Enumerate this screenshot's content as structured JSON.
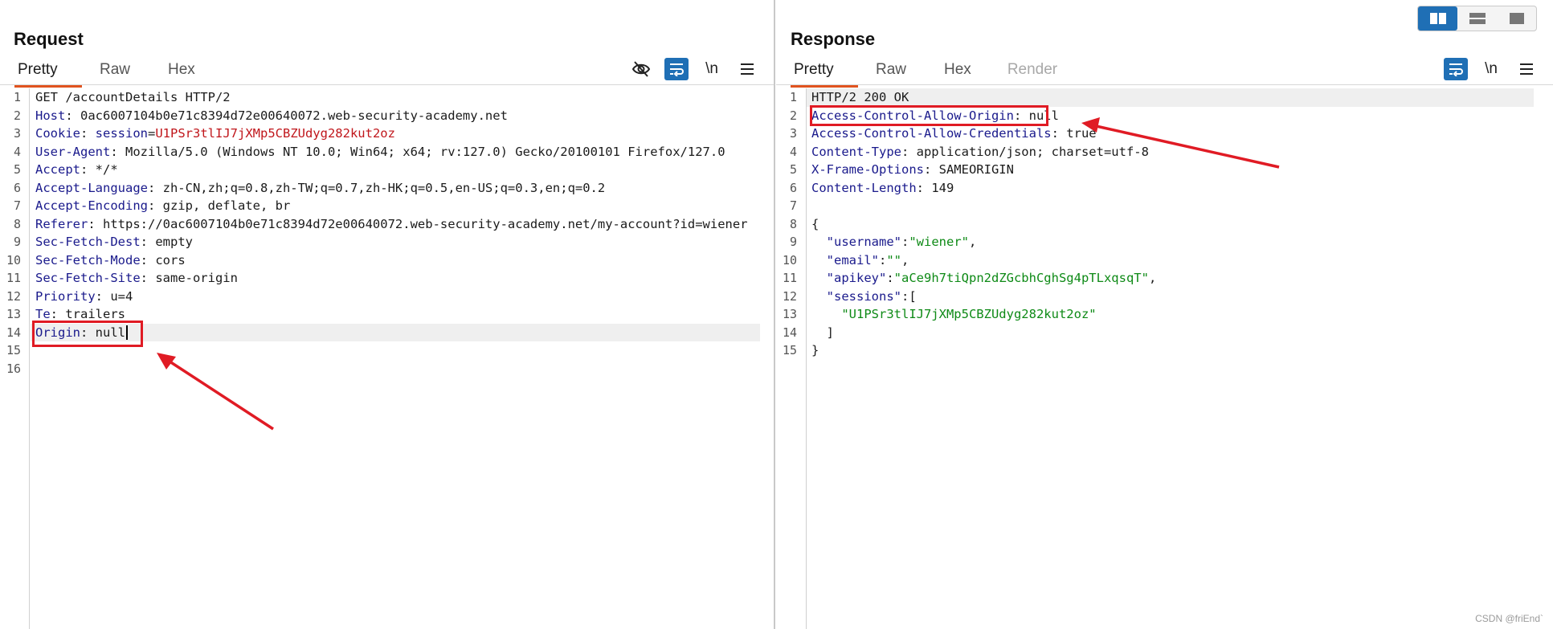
{
  "request": {
    "title": "Request",
    "tabs": [
      "Pretty",
      "Raw",
      "Hex"
    ],
    "active_tab": "Pretty",
    "tools": [
      "eye-off-icon",
      "wrap-icon",
      "\\n",
      "menu-icon"
    ],
    "lines": [
      {
        "n": "1",
        "parts": [
          {
            "t": "GET /accountDetails HTTP/2",
            "c": "v"
          }
        ]
      },
      {
        "n": "2",
        "parts": [
          {
            "t": "Host",
            "c": "k"
          },
          {
            "t": ": 0ac6007104b0e71c8394d72e00640072.web-security-academy.net",
            "c": "v"
          }
        ]
      },
      {
        "n": "3",
        "parts": [
          {
            "t": "Cookie",
            "c": "k"
          },
          {
            "t": ": ",
            "c": "v"
          },
          {
            "t": "session",
            "c": "k"
          },
          {
            "t": "=",
            "c": "v"
          },
          {
            "t": "U1PSr3tlIJ7jXMp5CBZUdyg282kut2oz",
            "c": "cookie-val"
          }
        ]
      },
      {
        "n": "4",
        "parts": [
          {
            "t": "User-Agent",
            "c": "k"
          },
          {
            "t": ": Mozilla/5.0 (Windows NT 10.0; Win64; x64; rv:127.0) Gecko/20100101 Firefox/127.0",
            "c": "v"
          }
        ]
      },
      {
        "n": "5",
        "parts": [
          {
            "t": "Accept",
            "c": "k"
          },
          {
            "t": ": */*",
            "c": "v"
          }
        ]
      },
      {
        "n": "6",
        "parts": [
          {
            "t": "Accept-Language",
            "c": "k"
          },
          {
            "t": ": zh-CN,zh;q=0.8,zh-TW;q=0.7,zh-HK;q=0.5,en-US;q=0.3,en;q=0.2",
            "c": "v"
          }
        ]
      },
      {
        "n": "7",
        "parts": [
          {
            "t": "Accept-Encoding",
            "c": "k"
          },
          {
            "t": ": gzip, deflate, br",
            "c": "v"
          }
        ]
      },
      {
        "n": "8",
        "parts": [
          {
            "t": "Referer",
            "c": "k"
          },
          {
            "t": ": https://0ac6007104b0e71c8394d72e00640072.web-security-academy.net/my-account?id=wiener",
            "c": "v"
          }
        ]
      },
      {
        "n": "9",
        "parts": [
          {
            "t": "Sec-Fetch-Dest",
            "c": "k"
          },
          {
            "t": ": empty",
            "c": "v"
          }
        ]
      },
      {
        "n": "10",
        "parts": [
          {
            "t": "Sec-Fetch-Mode",
            "c": "k"
          },
          {
            "t": ": cors",
            "c": "v"
          }
        ]
      },
      {
        "n": "11",
        "parts": [
          {
            "t": "Sec-Fetch-Site",
            "c": "k"
          },
          {
            "t": ": same-origin",
            "c": "v"
          }
        ]
      },
      {
        "n": "12",
        "parts": [
          {
            "t": "Priority",
            "c": "k"
          },
          {
            "t": ": u=4",
            "c": "v"
          }
        ]
      },
      {
        "n": "13",
        "parts": [
          {
            "t": "Te",
            "c": "k"
          },
          {
            "t": ": trailers",
            "c": "v"
          }
        ]
      },
      {
        "n": "14",
        "parts": [
          {
            "t": "Origin",
            "c": "k"
          },
          {
            "t": ": null",
            "c": "v"
          }
        ],
        "highlight": true,
        "caret": true
      },
      {
        "n": "15",
        "parts": []
      },
      {
        "n": "16",
        "parts": []
      }
    ]
  },
  "response": {
    "title": "Response",
    "tabs": [
      "Pretty",
      "Raw",
      "Hex",
      "Render"
    ],
    "active_tab": "Pretty",
    "tools": [
      "wrap-icon",
      "\\n",
      "menu-icon"
    ],
    "lines": [
      {
        "n": "1",
        "parts": [
          {
            "t": "HTTP/2 200 OK",
            "c": "v"
          }
        ],
        "highlight": true
      },
      {
        "n": "2",
        "parts": [
          {
            "t": "Access-Control-Allow-Origin",
            "c": "k"
          },
          {
            "t": ": null",
            "c": "v"
          }
        ]
      },
      {
        "n": "3",
        "parts": [
          {
            "t": "Access-Control-Allow-Credentials",
            "c": "k"
          },
          {
            "t": ": true",
            "c": "v"
          }
        ]
      },
      {
        "n": "4",
        "parts": [
          {
            "t": "Content-Type",
            "c": "k"
          },
          {
            "t": ": application/json; charset=utf-8",
            "c": "v"
          }
        ]
      },
      {
        "n": "5",
        "parts": [
          {
            "t": "X-Frame-Options",
            "c": "k"
          },
          {
            "t": ": SAMEORIGIN",
            "c": "v"
          }
        ]
      },
      {
        "n": "6",
        "parts": [
          {
            "t": "Content-Length",
            "c": "k"
          },
          {
            "t": ": 149",
            "c": "v"
          }
        ]
      },
      {
        "n": "7",
        "parts": []
      },
      {
        "n": "8",
        "parts": [
          {
            "t": "{",
            "c": "v"
          }
        ]
      },
      {
        "n": "9",
        "parts": [
          {
            "t": "  ",
            "c": "v"
          },
          {
            "t": "\"username\"",
            "c": "jk"
          },
          {
            "t": ":",
            "c": "v"
          },
          {
            "t": "\"wiener\"",
            "c": "js"
          },
          {
            "t": ",",
            "c": "v"
          }
        ]
      },
      {
        "n": "10",
        "parts": [
          {
            "t": "  ",
            "c": "v"
          },
          {
            "t": "\"email\"",
            "c": "jk"
          },
          {
            "t": ":",
            "c": "v"
          },
          {
            "t": "\"\"",
            "c": "js"
          },
          {
            "t": ",",
            "c": "v"
          }
        ]
      },
      {
        "n": "11",
        "parts": [
          {
            "t": "  ",
            "c": "v"
          },
          {
            "t": "\"apikey\"",
            "c": "jk"
          },
          {
            "t": ":",
            "c": "v"
          },
          {
            "t": "\"aCe9h7tiQpn2dZGcbhCghSg4pTLxqsqT\"",
            "c": "js"
          },
          {
            "t": ",",
            "c": "v"
          }
        ]
      },
      {
        "n": "12",
        "parts": [
          {
            "t": "  ",
            "c": "v"
          },
          {
            "t": "\"sessions\"",
            "c": "jk"
          },
          {
            "t": ":[",
            "c": "v"
          }
        ]
      },
      {
        "n": "13",
        "parts": [
          {
            "t": "    ",
            "c": "v"
          },
          {
            "t": "\"U1PSr3tlIJ7jXMp5CBZUdyg282kut2oz\"",
            "c": "js"
          }
        ]
      },
      {
        "n": "14",
        "parts": [
          {
            "t": "  ]",
            "c": "v"
          }
        ]
      },
      {
        "n": "15",
        "parts": [
          {
            "t": "}",
            "c": "v"
          }
        ]
      }
    ]
  },
  "watermark": "CSDN @friEnd`",
  "colors": {
    "accent": "#1f6fb5",
    "tab_underline": "#e0531f",
    "annotation": "#e01b24",
    "header_key": "#1a1a8c",
    "json_string": "#0e8a16",
    "cookie_value": "#c0161b"
  }
}
